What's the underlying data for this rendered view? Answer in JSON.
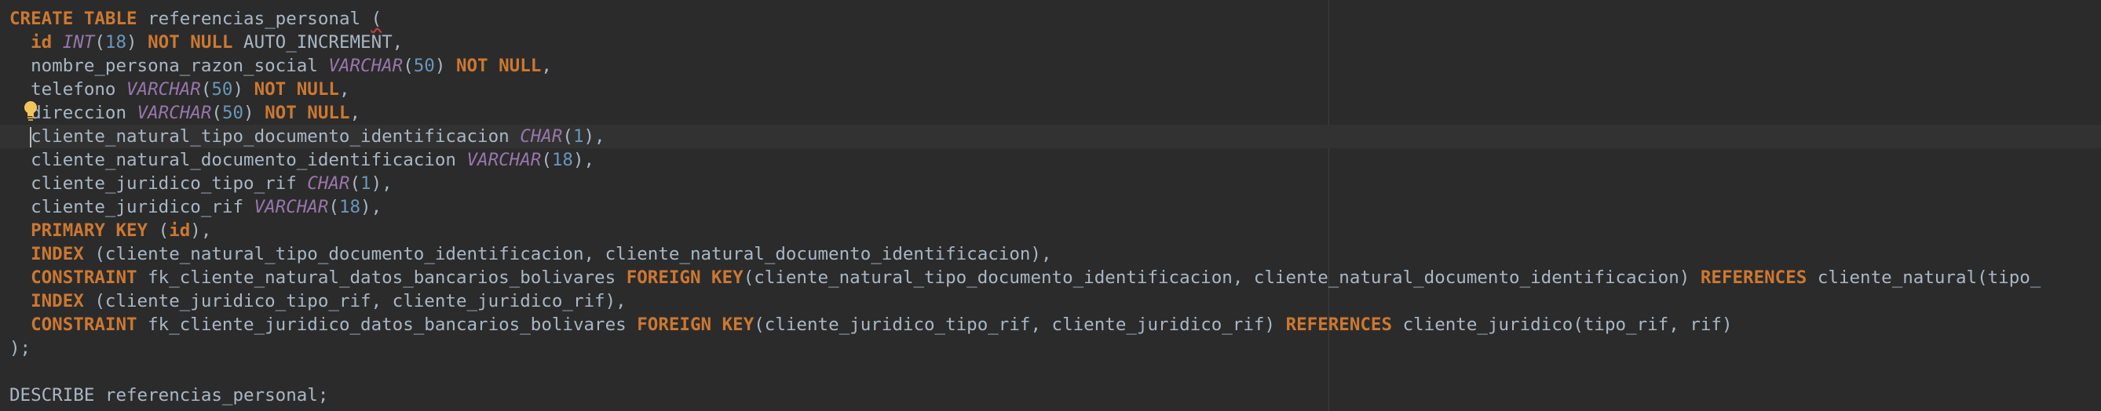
{
  "editor": {
    "language": "sql",
    "lines": [
      {
        "indent": "",
        "tokens": [
          {
            "c": "kw",
            "t": "CREATE"
          },
          {
            "c": "id",
            "t": " "
          },
          {
            "c": "kw",
            "t": "TABLE"
          },
          {
            "c": "id",
            "t": " referencias_personal "
          },
          {
            "c": "wavy",
            "t": "("
          }
        ]
      },
      {
        "indent": "  ",
        "tokens": [
          {
            "c": "idbold",
            "t": "id"
          },
          {
            "c": "id",
            "t": " "
          },
          {
            "c": "ty",
            "t": "INT"
          },
          {
            "c": "id",
            "t": "("
          },
          {
            "c": "num",
            "t": "18"
          },
          {
            "c": "id",
            "t": ") "
          },
          {
            "c": "kw",
            "t": "NOT NULL"
          },
          {
            "c": "id",
            "t": " AUTO_INCREMENT,"
          }
        ]
      },
      {
        "indent": "  ",
        "tokens": [
          {
            "c": "id",
            "t": "nombre_persona_razon_social "
          },
          {
            "c": "ty",
            "t": "VARCHAR"
          },
          {
            "c": "id",
            "t": "("
          },
          {
            "c": "num",
            "t": "50"
          },
          {
            "c": "id",
            "t": ") "
          },
          {
            "c": "kw",
            "t": "NOT NULL"
          },
          {
            "c": "id",
            "t": ","
          }
        ]
      },
      {
        "indent": "  ",
        "tokens": [
          {
            "c": "id",
            "t": "telefono "
          },
          {
            "c": "ty",
            "t": "VARCHAR"
          },
          {
            "c": "id",
            "t": "("
          },
          {
            "c": "num",
            "t": "50"
          },
          {
            "c": "id",
            "t": ") "
          },
          {
            "c": "kw",
            "t": "NOT NULL"
          },
          {
            "c": "id",
            "t": ","
          }
        ]
      },
      {
        "indent": "  ",
        "tokens": [
          {
            "c": "id",
            "t": "direccion "
          },
          {
            "c": "ty",
            "t": "VARCHAR"
          },
          {
            "c": "id",
            "t": "("
          },
          {
            "c": "num",
            "t": "50"
          },
          {
            "c": "id",
            "t": ") "
          },
          {
            "c": "kw",
            "t": "NOT NULL"
          },
          {
            "c": "id",
            "t": ","
          }
        ]
      },
      {
        "indent": "  ",
        "tokens": [
          {
            "c": "id",
            "t": "cliente_natural_tipo_documento_identificacion "
          },
          {
            "c": "ty",
            "t": "CHAR"
          },
          {
            "c": "id",
            "t": "("
          },
          {
            "c": "num",
            "t": "1"
          },
          {
            "c": "id",
            "t": "),"
          }
        ]
      },
      {
        "indent": "  ",
        "tokens": [
          {
            "c": "id",
            "t": "cliente_natural_documento_identificacion "
          },
          {
            "c": "ty",
            "t": "VARCHAR"
          },
          {
            "c": "id",
            "t": "("
          },
          {
            "c": "num",
            "t": "18"
          },
          {
            "c": "id",
            "t": "),"
          }
        ]
      },
      {
        "indent": "  ",
        "tokens": [
          {
            "c": "id",
            "t": "cliente_juridico_tipo_rif "
          },
          {
            "c": "ty",
            "t": "CHAR"
          },
          {
            "c": "id",
            "t": "("
          },
          {
            "c": "num",
            "t": "1"
          },
          {
            "c": "id",
            "t": "),"
          }
        ]
      },
      {
        "indent": "  ",
        "tokens": [
          {
            "c": "id",
            "t": "cliente_juridico_rif "
          },
          {
            "c": "ty",
            "t": "VARCHAR"
          },
          {
            "c": "id",
            "t": "("
          },
          {
            "c": "num",
            "t": "18"
          },
          {
            "c": "id",
            "t": "),"
          }
        ]
      },
      {
        "indent": "  ",
        "tokens": [
          {
            "c": "kw",
            "t": "PRIMARY KEY"
          },
          {
            "c": "id",
            "t": " ("
          },
          {
            "c": "idbold",
            "t": "id"
          },
          {
            "c": "id",
            "t": "),"
          }
        ]
      },
      {
        "indent": "  ",
        "tokens": [
          {
            "c": "kw",
            "t": "INDEX"
          },
          {
            "c": "id",
            "t": " (cliente_natural_tipo_documento_identificacion, cliente_natural_documento_identificacion),"
          }
        ]
      },
      {
        "indent": "  ",
        "tokens": [
          {
            "c": "kw",
            "t": "CONSTRAINT"
          },
          {
            "c": "id",
            "t": " fk_cliente_natural_datos_bancarios_bolivares "
          },
          {
            "c": "kw",
            "t": "FOREIGN KEY"
          },
          {
            "c": "id",
            "t": "(cliente_natural_tipo_documento_identificacion, cliente_natural_documento_identificacion) "
          },
          {
            "c": "kw",
            "t": "REFERENCES"
          },
          {
            "c": "id",
            "t": " cliente_natural(tipo_"
          }
        ]
      },
      {
        "indent": "  ",
        "tokens": [
          {
            "c": "kw",
            "t": "INDEX"
          },
          {
            "c": "id",
            "t": " (cliente_juridico_tipo_rif, cliente_juridico_rif),"
          }
        ]
      },
      {
        "indent": "  ",
        "tokens": [
          {
            "c": "kw",
            "t": "CONSTRAINT"
          },
          {
            "c": "id",
            "t": " fk_cliente_juridico_datos_bancarios_bolivares "
          },
          {
            "c": "kw",
            "t": "FOREIGN KEY"
          },
          {
            "c": "id",
            "t": "(cliente_juridico_tipo_rif, cliente_juridico_rif) "
          },
          {
            "c": "kw",
            "t": "REFERENCES"
          },
          {
            "c": "id",
            "t": " cliente_juridico(tipo_rif, rif)"
          }
        ]
      },
      {
        "indent": "",
        "tokens": [
          {
            "c": "id",
            "t": ");"
          }
        ]
      },
      {
        "indent": "",
        "tokens": []
      },
      {
        "indent": "",
        "tokens": [
          {
            "c": "id",
            "t": "DESCRIBE referencias_personal;"
          }
        ]
      }
    ],
    "highlighted_line": 5,
    "colors": {
      "background": "#2b2b2b",
      "keyword": "#cc7832",
      "type": "#9876aa",
      "number": "#6897bb",
      "identifier": "#a9b7c6",
      "current_line": "#323232",
      "bulb": "#f2c55c"
    }
  }
}
